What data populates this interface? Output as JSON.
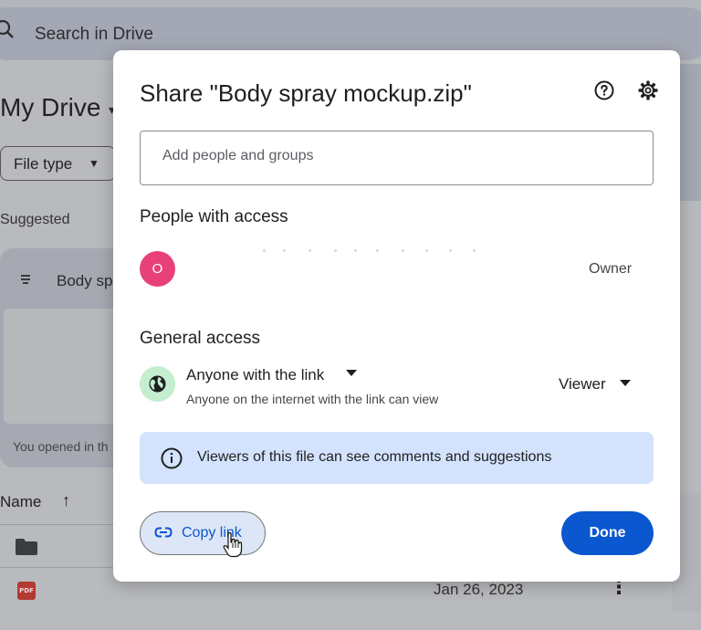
{
  "background": {
    "search": {
      "placeholder": "Search in Drive"
    },
    "page_title": "My Drive",
    "filters": {
      "file_type": "File type"
    },
    "suggested_label": "Suggested",
    "suggested_card": {
      "name": "Body sp",
      "subtitle": "You opened in th"
    },
    "list": {
      "name_header": "Name",
      "rows": [
        {
          "type": "folder",
          "date": ""
        },
        {
          "type": "pdf",
          "date": "Jan 26, 2023"
        }
      ]
    }
  },
  "dialog": {
    "title": "Share \"Body spray mockup.zip\"",
    "add_people_placeholder": "Add people and groups",
    "people_section": "People with access",
    "owner": {
      "initial": "O",
      "role": "Owner",
      "avatar_color": "#e8407a"
    },
    "general_section": "General access",
    "access": {
      "mode": "Anyone with the link",
      "description": "Anyone on the internet with the link can view",
      "role": "Viewer"
    },
    "info_banner": "Viewers of this file can see comments and suggestions",
    "copy_link": "Copy link",
    "done": "Done",
    "colors": {
      "accent": "#0b57d0",
      "banner_bg": "#d3e3fd",
      "globe_bg": "#c4eed0"
    },
    "icons": [
      "help-icon",
      "settings-icon",
      "globe-icon",
      "info-icon",
      "link-icon"
    ]
  }
}
